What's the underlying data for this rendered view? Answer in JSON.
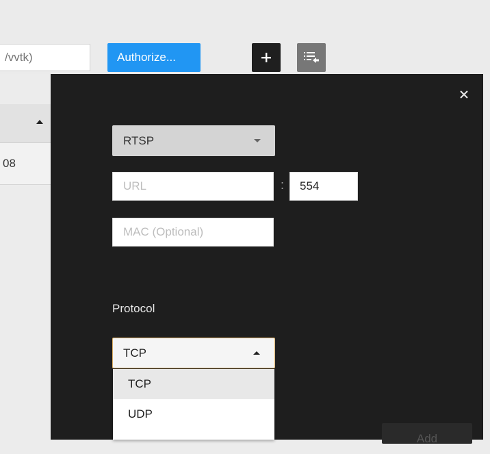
{
  "toolbar": {
    "path_value": "/vvtk)",
    "authorize_label": "Authorize...",
    "add_icon": "plus-icon",
    "import_icon": "import-list-icon",
    "accent_color": "#2196f3"
  },
  "background_table": {
    "sort_icon": "sort-ascending-icon",
    "row_cell": "08"
  },
  "dialog": {
    "close_icon": "close-icon",
    "source_select": {
      "value": "RTSP"
    },
    "url": {
      "placeholder": "URL",
      "value": ""
    },
    "port_separator": ":",
    "port": {
      "value": "554"
    },
    "mac": {
      "placeholder": "MAC (Optional)",
      "value": ""
    },
    "protocol_label": "Protocol",
    "protocol_select": {
      "value": "TCP",
      "options": [
        "TCP",
        "UDP"
      ]
    },
    "add_label": "Add"
  }
}
